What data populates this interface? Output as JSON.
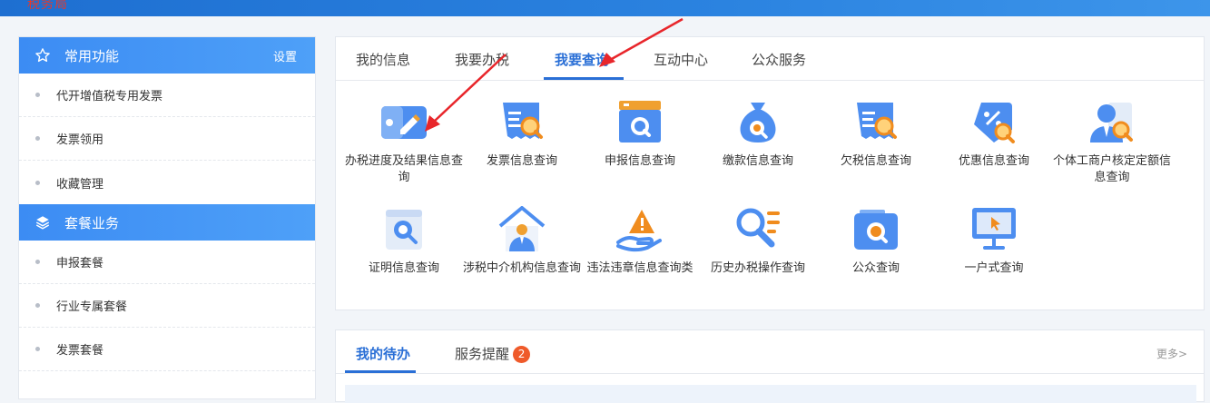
{
  "header": {
    "logo_fragment": "税务局"
  },
  "sidebar": {
    "sections": [
      {
        "title": "常用功能",
        "action": "设置",
        "items": [
          "代开增值税专用发票",
          "发票领用",
          "收藏管理"
        ]
      },
      {
        "title": "套餐业务",
        "items": [
          "申报套餐",
          "行业专属套餐",
          "发票套餐"
        ]
      }
    ]
  },
  "main": {
    "tabs": [
      "我的信息",
      "我要办税",
      "我要查询",
      "互动中心",
      "公众服务"
    ],
    "active_tab": "我要查询",
    "grid": [
      {
        "label": "办税进度及结果信息查询",
        "icon": "pencil-card-icon"
      },
      {
        "label": "发票信息查询",
        "icon": "invoice-search-icon"
      },
      {
        "label": "申报信息查询",
        "icon": "declaration-search-icon"
      },
      {
        "label": "缴款信息查询",
        "icon": "money-bag-search-icon"
      },
      {
        "label": "欠税信息查询",
        "icon": "arrears-search-icon"
      },
      {
        "label": "优惠信息查询",
        "icon": "discount-tag-search-icon"
      },
      {
        "label": "个体工商户核定定额信息查询",
        "icon": "person-search-icon"
      },
      {
        "label": "证明信息查询",
        "icon": "certificate-search-icon"
      },
      {
        "label": "涉税中介机构信息查询",
        "icon": "house-agent-icon"
      },
      {
        "label": "违法违章信息查询类",
        "icon": "warning-hand-icon"
      },
      {
        "label": "历史办税操作查询",
        "icon": "history-search-list-icon"
      },
      {
        "label": "公众查询",
        "icon": "public-search-icon"
      },
      {
        "label": "一户式查询",
        "icon": "monitor-cursor-icon"
      }
    ]
  },
  "todo": {
    "tabs": [
      "我的待办",
      "服务提醒"
    ],
    "badge": "2",
    "more": "更多>"
  },
  "colors": {
    "accent": "#2a6fd6",
    "header_blue": "#3c8cf3",
    "badge": "#ef5a2a",
    "arrow": "#e8262b"
  }
}
